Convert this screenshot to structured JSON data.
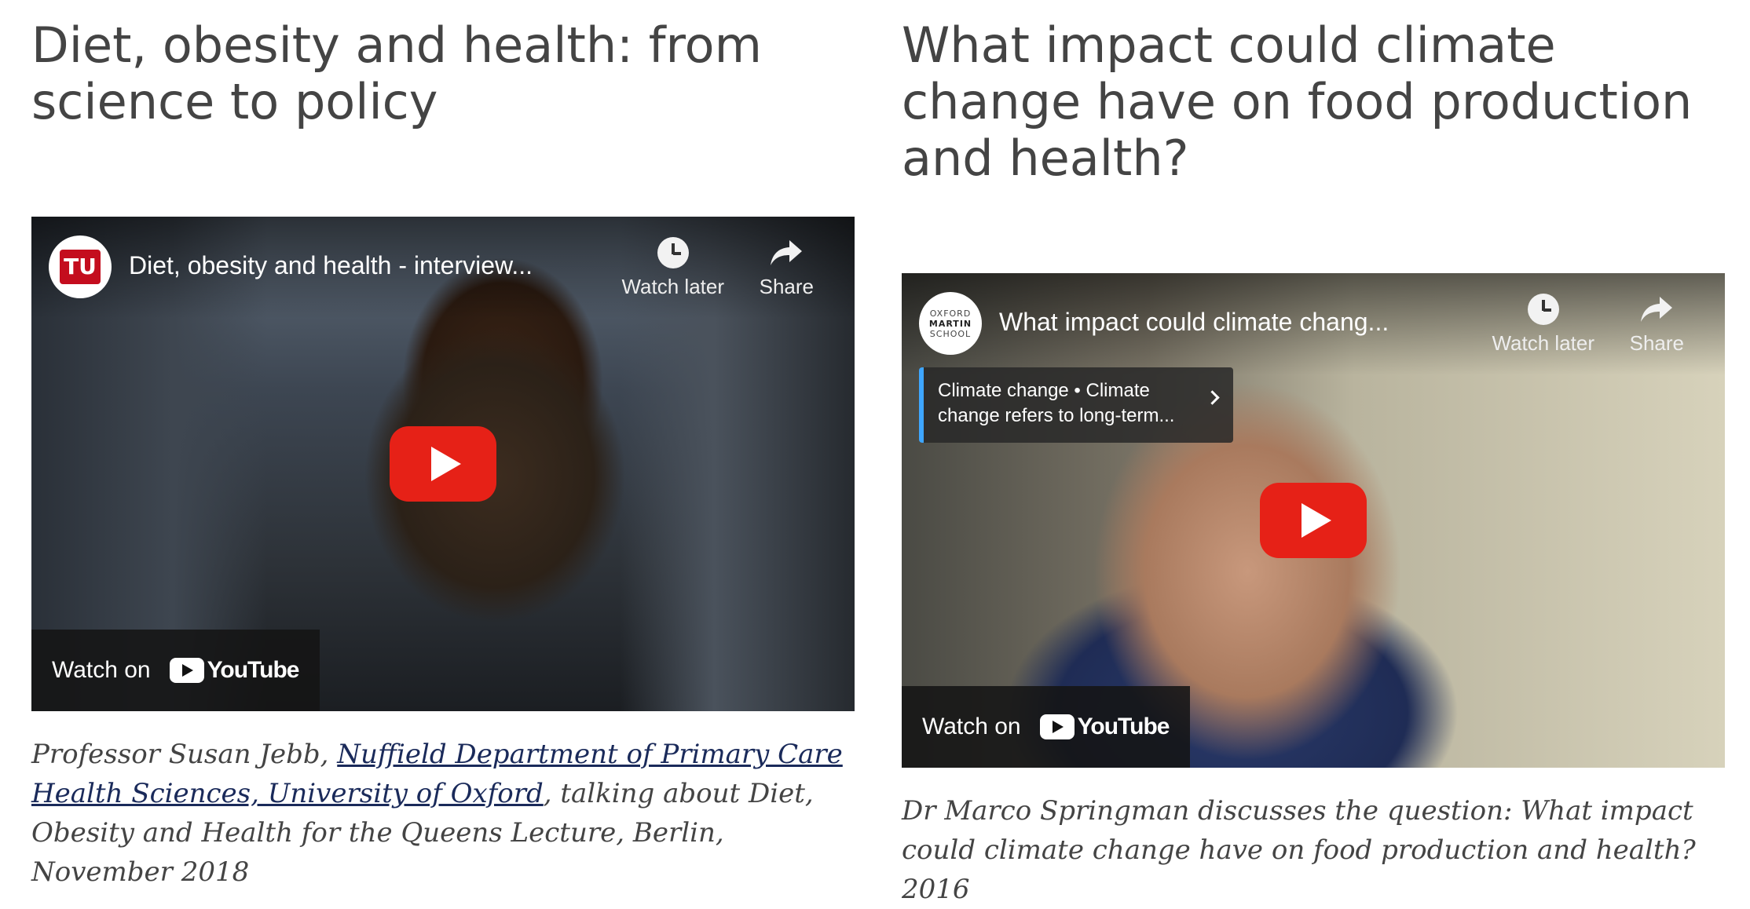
{
  "articles": [
    {
      "heading": "Diet, obesity and health: from science to policy",
      "video": {
        "channel": "TU Berlin",
        "title": "Diet, obesity and health - interview...",
        "watch_later": "Watch later",
        "share": "Share",
        "watch_on": "Watch on",
        "youtube": "YouTube"
      },
      "caption": {
        "prefix": "Professor Susan Jebb, ",
        "link": "Nuffield Department of Primary Care Health Sciences, University of Oxford",
        "suffix": ", talking about Diet, Obesity and Health for the Queens Lecture, Berlin, November 2018"
      }
    },
    {
      "heading": "What impact could climate change have on food production and health?",
      "video": {
        "channel_logo_lines": [
          "OXFORD",
          "MARTIN",
          "SCHOOL"
        ],
        "title": "What impact could climate chang...",
        "watch_later": "Watch later",
        "share": "Share",
        "info_card": "Climate change • Climate change refers to long-term...",
        "watch_on": "Watch on",
        "youtube": "YouTube"
      },
      "caption": {
        "text": "Dr Marco Springman discusses the question: What impact could climate change have on food production and health? 2016"
      }
    }
  ],
  "colors": {
    "heading": "#444444",
    "caption": "#444444",
    "link": "#1a2a5a",
    "play_button": "#e62117",
    "info_card_accent": "#3ea6ff"
  }
}
